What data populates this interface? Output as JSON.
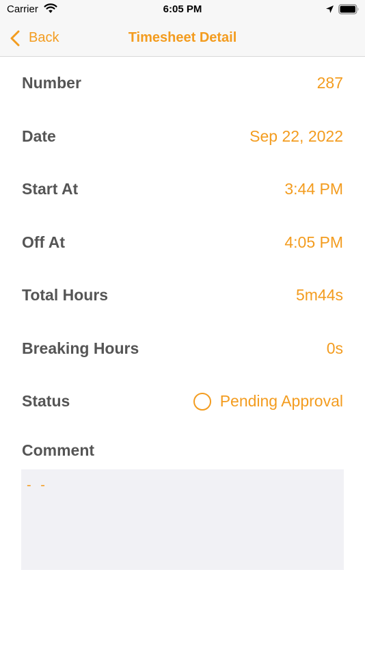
{
  "status_bar": {
    "carrier": "Carrier",
    "time": "6:05 PM",
    "icons": [
      "wifi-icon",
      "location-arrow-icon",
      "battery-icon"
    ]
  },
  "nav": {
    "back_label": "Back",
    "title": "Timesheet Detail"
  },
  "rows": [
    {
      "label": "Number",
      "value": "287"
    },
    {
      "label": "Date",
      "value": "Sep 22, 2022"
    },
    {
      "label": "Start At",
      "value": "3:44 PM"
    },
    {
      "label": "Off At",
      "value": "4:05 PM"
    },
    {
      "label": "Total Hours",
      "value": "5m44s"
    },
    {
      "label": "Breaking Hours",
      "value": "0s"
    }
  ],
  "status": {
    "label": "Status",
    "value": "Pending Approval",
    "icon": "circle-outline-icon"
  },
  "comment": {
    "label": "Comment",
    "value": "- -"
  },
  "colors": {
    "accent": "#f39c1f",
    "label_text": "#555555",
    "nav_background": "#f7f7f7",
    "comment_background": "#f1f1f5"
  }
}
